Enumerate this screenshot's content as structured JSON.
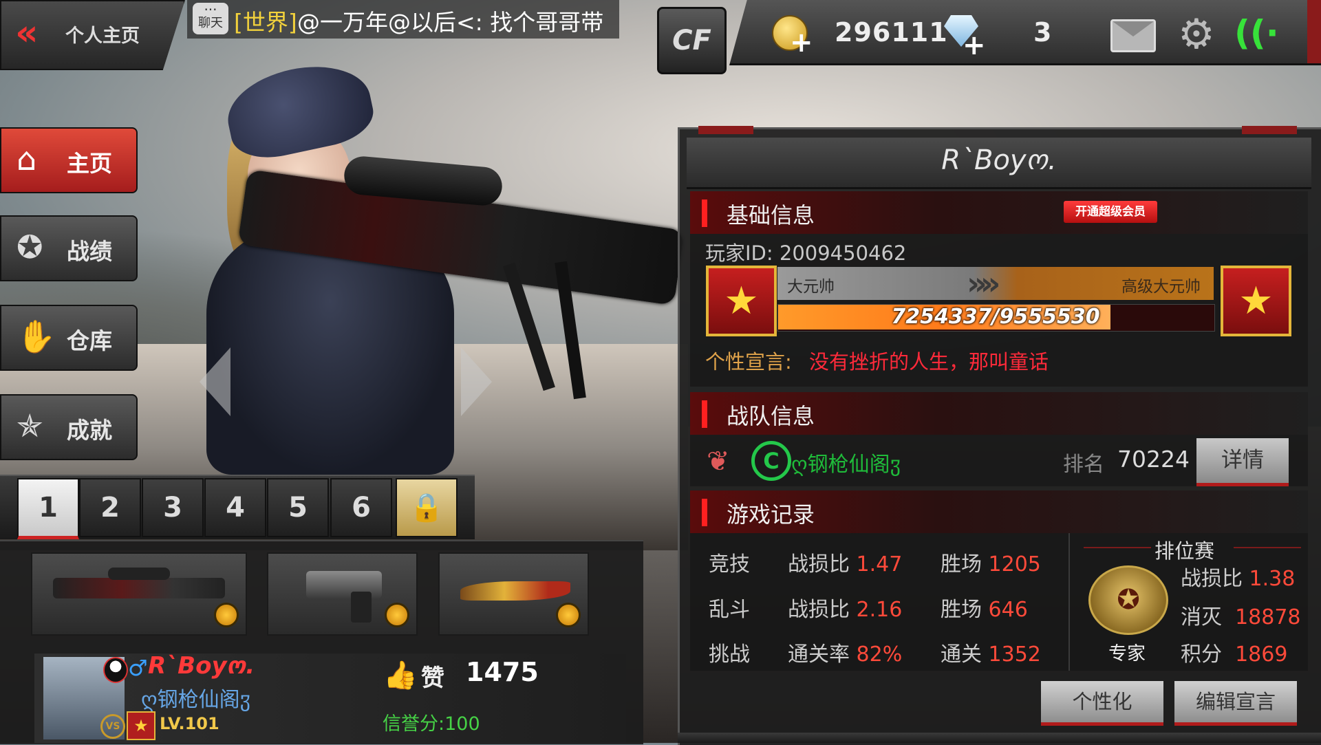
{
  "top_bar": {
    "back_label": "个人主页",
    "chat_icon_label": "聊天",
    "chat_channel": "[世界]",
    "chat_message": "@一万年@以后<: 找个哥哥带",
    "logo_text": "CF",
    "gold": "296111",
    "diamonds": "3"
  },
  "nav": {
    "home": "主页",
    "stats": "战绩",
    "warehouse": "仓库",
    "achievements": "成就"
  },
  "loadout_tabs": [
    "1",
    "2",
    "3",
    "4",
    "5",
    "6"
  ],
  "player": {
    "name": "R`Boyო.",
    "clan": "ღ钢枪仙阁ჳ",
    "level": "LV.101",
    "vs_badge": "VS",
    "like_label": "赞",
    "likes": "1475",
    "credit": "信誉分:100"
  },
  "panel": {
    "title": "R`Boyო.",
    "basic_section": "基础信息",
    "vip_button": "开通超级会员",
    "player_id": "玩家ID: 2009450462",
    "rank_current": "大元帅",
    "rank_next": "高级大元帅",
    "xp_text": "7254337/9555530",
    "xp_fraction": 0.759,
    "motto_label": "个性宣言:",
    "motto": "没有挫折的人生，那叫童话",
    "team_section": "战队信息",
    "team_name": "ღ钢枪仙阁ჳ",
    "team_rank_label": "排名",
    "team_rank": "70224",
    "details_button": "详情",
    "record_section": "游戏记录",
    "records": [
      {
        "mode": "竞技",
        "k1": "战损比",
        "v1": "1.47",
        "k2": "胜场",
        "v2": "1205"
      },
      {
        "mode": "乱斗",
        "k1": "战损比",
        "v1": "2.16",
        "k2": "胜场",
        "v2": "646"
      },
      {
        "mode": "挑战",
        "k1": "通关率",
        "v1": "82%",
        "k2": "通关",
        "v2": "1352"
      }
    ],
    "ranked": {
      "title": "排位赛",
      "tier": "专家",
      "kd_label": "战损比",
      "kd": "1.38",
      "kills_label": "消灭",
      "kills": "18878",
      "points_label": "积分",
      "points": "1869"
    },
    "customize_button": "个性化",
    "edit_motto_button": "编辑宣言"
  },
  "colors": {
    "accent_red": "#e33333",
    "xp_orange": "#ff8a1a",
    "clan_green": "#1fbb3a",
    "motto_red": "#ff2a3a",
    "stat_red": "#ff4a3a",
    "wifi_green": "#37e23a"
  },
  "icons": {
    "back": "double-chevron-left-icon",
    "gold": "gold-coin-icon",
    "gem": "diamond-icon",
    "mail": "mail-icon",
    "settings": "gear-icon",
    "wifi": "wifi-icon",
    "home": "house-icon",
    "stats": "star-wings-icon",
    "warehouse": "hand-box-icon",
    "achievements": "trophy-star-icon",
    "lock": "padlock-icon",
    "like": "thumbs-up-icon"
  }
}
